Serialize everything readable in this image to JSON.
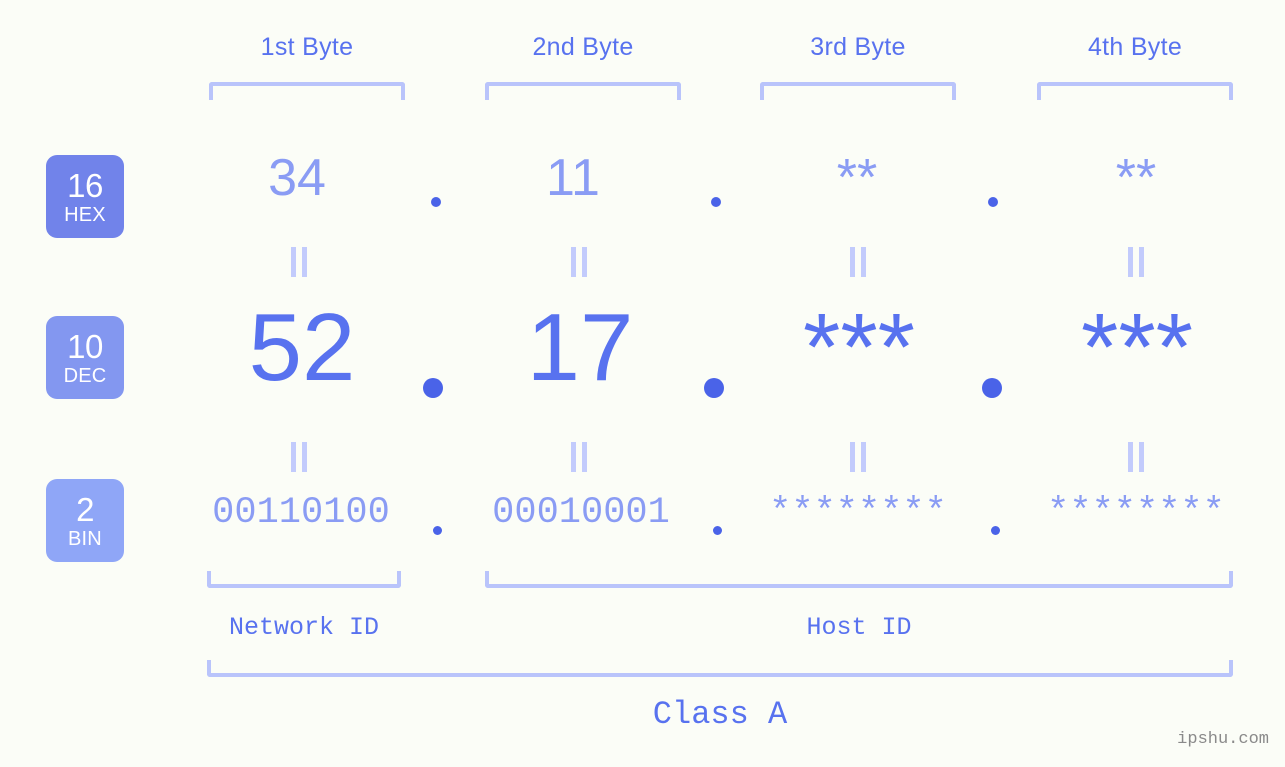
{
  "meta": {
    "background": "#fbfdf7",
    "accent_strong": "#5872ef",
    "accent_mid": "#8a9cf4",
    "accent_light": "#b9c4fb",
    "dot_color": "#4a63e8"
  },
  "headers": [
    {
      "label": "1st Byte"
    },
    {
      "label": "2nd Byte"
    },
    {
      "label": "3rd Byte"
    },
    {
      "label": "4th Byte"
    }
  ],
  "radix_badges": [
    {
      "number": "16",
      "label": "HEX",
      "color": "#7183ea"
    },
    {
      "number": "10",
      "label": "DEC",
      "color": "#8397f0"
    },
    {
      "number": "2",
      "label": "BIN",
      "color": "#8fa6f7"
    }
  ],
  "rows": {
    "hex": {
      "radix": "16",
      "radix_label": "HEX",
      "values": [
        "34",
        "11",
        "**",
        "**"
      ],
      "separators": [
        ".",
        ".",
        "."
      ]
    },
    "dec": {
      "radix": "10",
      "radix_label": "DEC",
      "values": [
        "52",
        "17",
        "***",
        "***"
      ],
      "separators": [
        ".",
        ".",
        "."
      ]
    },
    "bin": {
      "radix": "2",
      "radix_label": "BIN",
      "values": [
        "00110100",
        "00010001",
        "********",
        "********"
      ],
      "separators": [
        ".",
        ".",
        "."
      ]
    }
  },
  "equality_marks": {
    "glyph": "=",
    "count_per_row_gap": 4
  },
  "sections": [
    {
      "name": "network-id",
      "label": "Network ID"
    },
    {
      "name": "host-id",
      "label": "Host ID"
    }
  ],
  "class_label": "Class A",
  "watermark": "ipshu.com"
}
